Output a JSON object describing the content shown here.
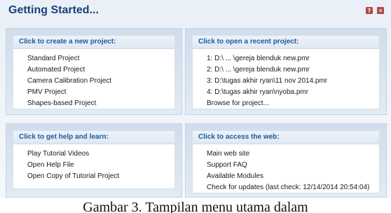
{
  "window": {
    "title": "Getting Started...",
    "help_icon": "help-icon",
    "close_icon": "close-icon"
  },
  "panels": {
    "new_project": {
      "header": "Click to create a new project:",
      "items": [
        "Standard Project",
        "Automated Project",
        "Camera Calibration Project",
        "PMV Project",
        "Shapes-based Project"
      ]
    },
    "recent_project": {
      "header": "Click to open a recent project:",
      "items": [
        "1: D:\\ ... \\gereja blenduk new.pmr",
        "2: D:\\ ... \\gereja blenduk new.pmr",
        "3: D:\\tugas akhir ryan\\11 nov 2014.pmr",
        "4: D:\\tugas akhir ryan\\nyoba.pmr",
        "Browse for project..."
      ]
    },
    "help": {
      "header": "Click to get help and learn:",
      "items": [
        "Play Tutorial Videos",
        "Open Help File",
        "Open Copy of Tutorial Project"
      ]
    },
    "web": {
      "header": "Click to access the web:",
      "items": [
        "Main web site",
        "Support FAQ",
        "Available Modules",
        "Check for updates (last check: 12/14/2014 20:54:04)"
      ]
    }
  },
  "caption": "Gambar 3. Tampilan menu utama dalam"
}
